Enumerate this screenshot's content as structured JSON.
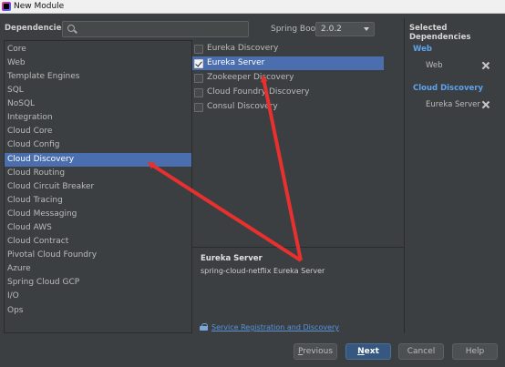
{
  "window": {
    "title": "New Module"
  },
  "header": {
    "dependencies_label": "Dependencies",
    "search_placeholder": "",
    "spring_boot_label": "Spring Boot",
    "spring_boot_version": "2.0.2"
  },
  "categories": [
    "Core",
    "Web",
    "Template Engines",
    "SQL",
    "NoSQL",
    "Integration",
    "Cloud Core",
    "Cloud Config",
    "Cloud Discovery",
    "Cloud Routing",
    "Cloud Circuit Breaker",
    "Cloud Tracing",
    "Cloud Messaging",
    "Cloud AWS",
    "Cloud Contract",
    "Pivotal Cloud Foundry",
    "Azure",
    "Spring Cloud GCP",
    "I/O",
    "Ops"
  ],
  "selected_category": "Cloud Discovery",
  "dependencies": [
    {
      "label": "Eureka Discovery",
      "checked": false
    },
    {
      "label": "Eureka Server",
      "checked": true
    },
    {
      "label": "Zookeeper Discovery",
      "checked": false
    },
    {
      "label": "Cloud Foundry Discovery",
      "checked": false
    },
    {
      "label": "Consul Discovery",
      "checked": false
    }
  ],
  "description": {
    "title": "Eureka Server",
    "text": "spring-cloud-netflix Eureka Server",
    "link": "Service Registration and Discovery"
  },
  "selected_dependencies": {
    "header": "Selected Dependencies",
    "groups": [
      {
        "name": "Web",
        "items": [
          "Web"
        ]
      },
      {
        "name": "Cloud Discovery",
        "items": [
          "Eureka Server"
        ]
      }
    ]
  },
  "buttons": {
    "previous": {
      "u": "P",
      "rest": "revious"
    },
    "next": {
      "u": "N",
      "rest": "ext"
    },
    "cancel": "Cancel",
    "help": "Help"
  },
  "colors": {
    "selection": "#4b6eaf",
    "annotation_arrow": "#e8302f",
    "link": "#5794dc"
  }
}
